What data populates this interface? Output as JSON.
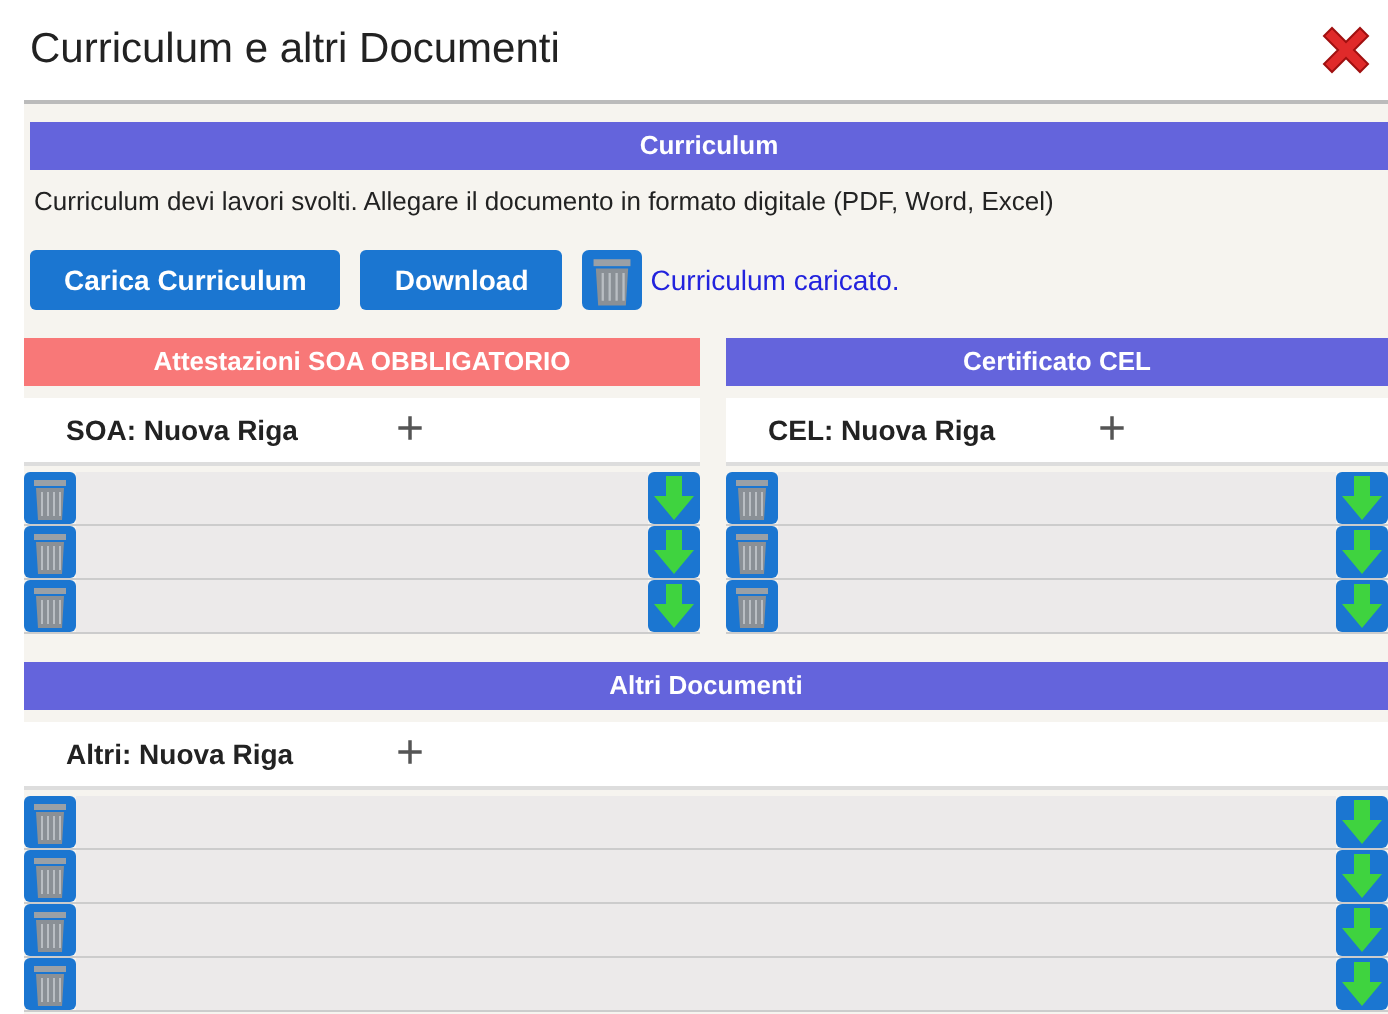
{
  "window": {
    "title": "Curriculum e altri Documenti"
  },
  "curriculum": {
    "header": "Curriculum",
    "description": "Curriculum devi lavori svolti. Allegare il documento in formato digitale (PDF, Word, Excel)",
    "buttons": [
      "Carica Curriculum",
      "Download"
    ],
    "status": "Curriculum caricato."
  },
  "sections": [
    {
      "header": "Attestazioni SOA OBBLIGATORIO",
      "color": "#f87878",
      "new_row_label": "SOA: Nuova Riga",
      "add": "+",
      "rows": [
        {
          "kind": "file"
        },
        {
          "kind": "file"
        },
        {
          "kind": "file"
        }
      ]
    },
    {
      "header": "Certificato CEL",
      "color": "#6464dc",
      "new_row_label": "CEL: Nuova Riga",
      "add": "+",
      "rows": [
        {
          "kind": "file"
        },
        {
          "kind": "file"
        },
        {
          "kind": "file"
        }
      ]
    },
    {
      "header": "Altri Documenti",
      "color": "#6464dc",
      "new_row_label": "Altri: Nuova Riga",
      "add": "+",
      "rows": [
        {
          "kind": "file"
        },
        {
          "kind": "file"
        },
        {
          "kind": "file"
        },
        {
          "kind": "file"
        }
      ]
    }
  ]
}
